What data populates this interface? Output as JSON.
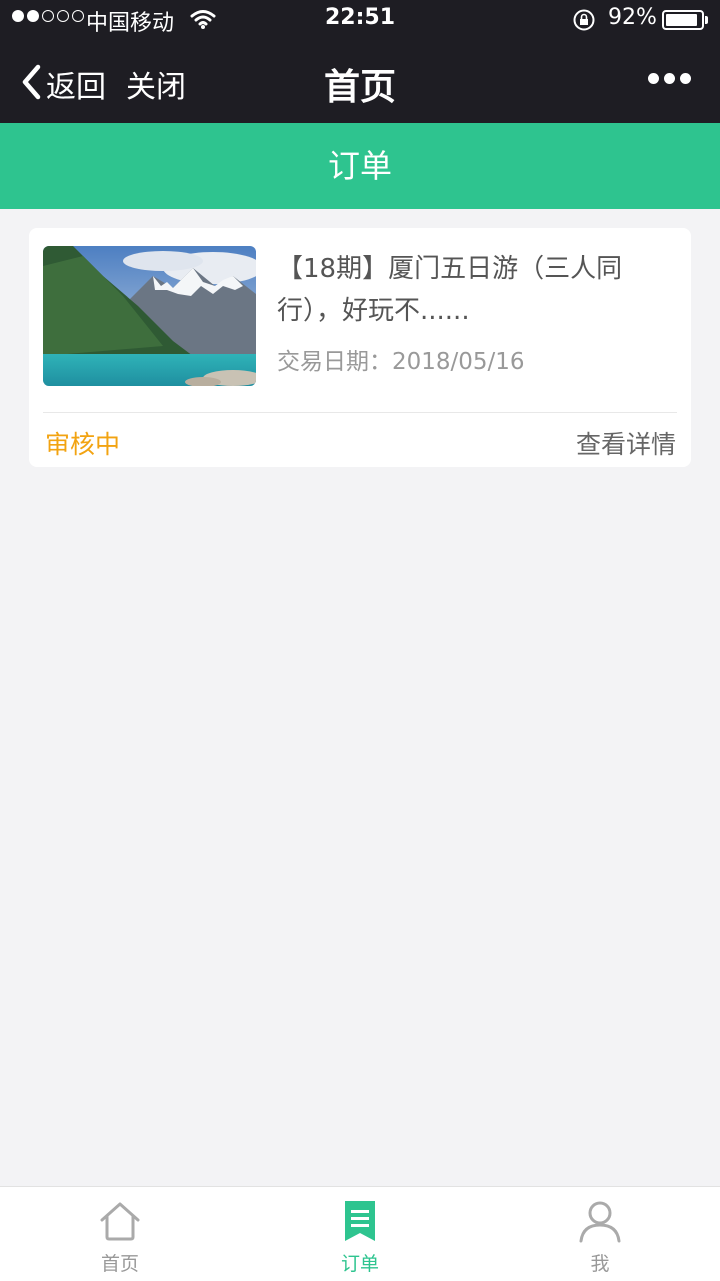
{
  "status_bar": {
    "carrier": "中国移动",
    "time": "22:51",
    "battery_percent": "92%",
    "battery_level": 0.92,
    "signal_bars_filled": 2,
    "signal_bars_total": 5
  },
  "nav": {
    "back_label": "返回",
    "close_label": "关闭",
    "title": "首页"
  },
  "subheader": {
    "title": "订单"
  },
  "order": {
    "title": "【18期】厦门五日游（三人同行），好玩不......",
    "date": "交易日期：2018/05/16",
    "status": "审核中",
    "detail_link": "查看详情"
  },
  "tabbar": {
    "items": [
      {
        "label": "首页",
        "icon": "home-icon",
        "active": false
      },
      {
        "label": "订单",
        "icon": "order-bookmark-icon",
        "active": true
      },
      {
        "label": "我",
        "icon": "user-icon",
        "active": false
      }
    ]
  },
  "colors": {
    "accent": "#2ec48f",
    "header_bg": "#1e1d23",
    "status_pending": "#f2a311",
    "page_bg": "#f3f3f5"
  }
}
